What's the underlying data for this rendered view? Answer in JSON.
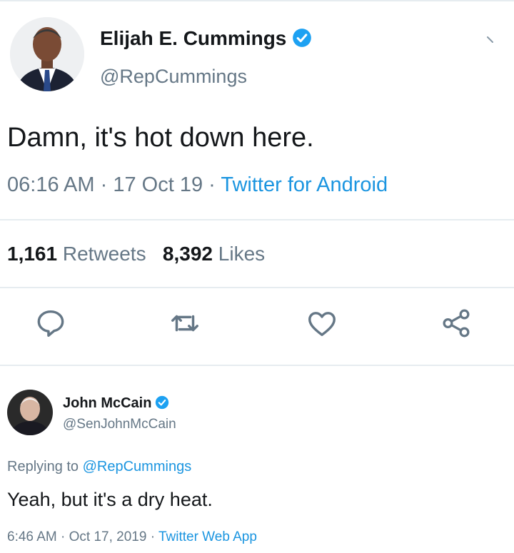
{
  "colors": {
    "text": "#14171a",
    "secondary": "#657786",
    "link": "#1b95e0",
    "verified": "#1da1f2",
    "divider": "#e6ecf0"
  },
  "tweet": {
    "author_name": "Elijah E. Cummings",
    "author_handle": "@RepCummings",
    "text": "Damn, it's hot down here.",
    "time": "06:16 AM",
    "date": "17 Oct 19",
    "separator": "·",
    "source": "Twitter for Android",
    "retweets_count": "1,161",
    "retweets_label": "Retweets",
    "likes_count": "8,392",
    "likes_label": "Likes",
    "actions": [
      "reply-icon",
      "retweet-icon",
      "like-icon",
      "share-icon"
    ]
  },
  "reply_tweet": {
    "author_name": "John McCain",
    "author_handle": "@SenJohnMcCain",
    "replying_to_prefix": "Replying to",
    "replying_to_handle": "@RepCummings",
    "text": "Yeah, but it's a dry heat.",
    "time": "6:46 AM",
    "date": "Oct 17, 2019",
    "separator": "·",
    "source": "Twitter Web App"
  }
}
